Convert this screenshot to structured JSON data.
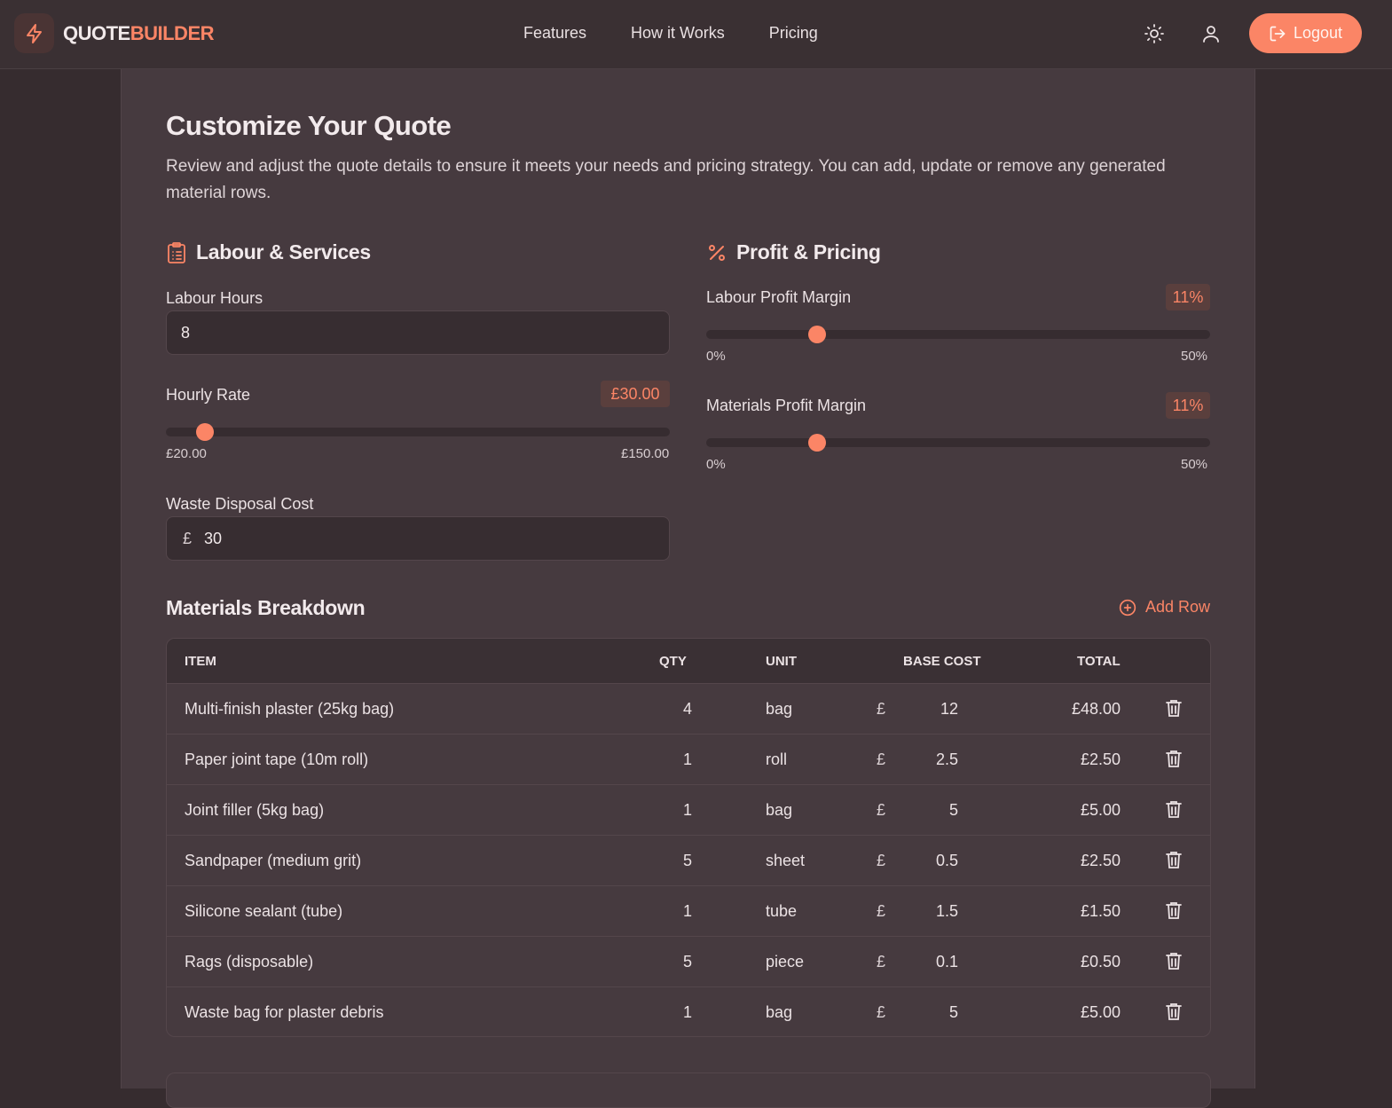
{
  "brand": {
    "part1": "QUOTE",
    "part2": "BUILDER"
  },
  "nav": {
    "links": [
      "Features",
      "How it Works",
      "Pricing"
    ],
    "logout": "Logout"
  },
  "page": {
    "title": "Customize Your Quote",
    "description": "Review and adjust the quote details to ensure it meets your needs and pricing strategy. You can add, update or remove any generated material rows."
  },
  "labour": {
    "title": "Labour & Services",
    "hours_label": "Labour Hours",
    "hours_value": "8",
    "rate_label": "Hourly Rate",
    "rate_value": "£30.00",
    "rate_fraction": 0.077,
    "rate_min": "£20.00",
    "rate_max": "£150.00",
    "waste_label": "Waste Disposal Cost",
    "waste_currency": "£",
    "waste_value": "30"
  },
  "profit": {
    "title": "Profit & Pricing",
    "labour_label": "Labour Profit Margin",
    "labour_value": "11%",
    "labour_fraction": 0.22,
    "materials_label": "Materials Profit Margin",
    "materials_value": "11%",
    "materials_fraction": 0.22,
    "min": "0%",
    "max": "50%"
  },
  "materials": {
    "title": "Materials Breakdown",
    "add_row": "Add Row",
    "columns": {
      "item": "ITEM",
      "qty": "QTY",
      "unit": "UNIT",
      "base_cost": "BASE COST",
      "total": "TOTAL"
    },
    "currency": "£",
    "rows": [
      {
        "item": "Multi-finish plaster (25kg bag)",
        "qty": "4",
        "unit": "bag",
        "base": "12",
        "total": "£48.00"
      },
      {
        "item": "Paper joint tape (10m roll)",
        "qty": "1",
        "unit": "roll",
        "base": "2.5",
        "total": "£2.50"
      },
      {
        "item": "Joint filler (5kg bag)",
        "qty": "1",
        "unit": "bag",
        "base": "5",
        "total": "£5.00"
      },
      {
        "item": "Sandpaper (medium grit)",
        "qty": "5",
        "unit": "sheet",
        "base": "0.5",
        "total": "£2.50"
      },
      {
        "item": "Silicone sealant (tube)",
        "qty": "1",
        "unit": "tube",
        "base": "1.5",
        "total": "£1.50"
      },
      {
        "item": "Rags (disposable)",
        "qty": "5",
        "unit": "piece",
        "base": "0.1",
        "total": "£0.50"
      },
      {
        "item": "Waste bag for plaster debris",
        "qty": "1",
        "unit": "bag",
        "base": "5",
        "total": "£5.00"
      }
    ]
  },
  "colors": {
    "accent": "#fb8566",
    "background": "#362c2f",
    "panel": "#463a3f"
  }
}
